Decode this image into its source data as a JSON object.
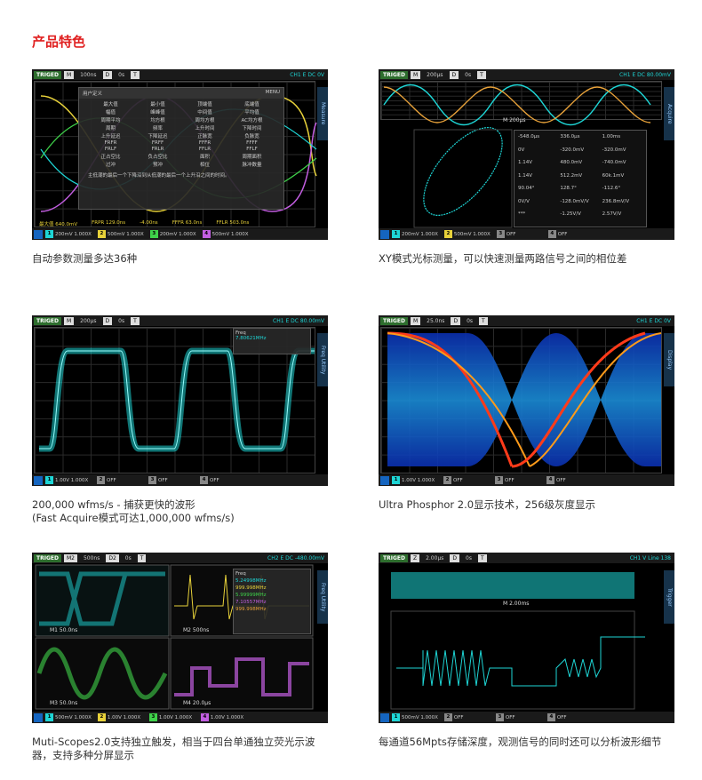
{
  "page_title": "产品特色",
  "cards": [
    {
      "caption": "自动参数测量多达36种",
      "top": {
        "trig": "TRIGED",
        "mode": "M",
        "timebase": "100ns",
        "delay_label": "D",
        "delay": "0s",
        "trig_label": "T",
        "trig_info": "CH1 E DC 0V"
      },
      "side_tab": "Measure",
      "menu_title": "用户定义",
      "menu_right": "MENU",
      "menu_items": [
        "最大值",
        "最小值",
        "顶端值",
        "底端值",
        "幅值",
        "峰峰值",
        "中间值",
        "平均值",
        "周期平均",
        "均方根",
        "周均方根",
        "AC均方根",
        "周期",
        "频率",
        "上升时间",
        "下降时间",
        "上升延迟",
        "下降延迟",
        "正脉宽",
        "负脉宽",
        "FRFR",
        "FRFF",
        "FFFR",
        "FFFF",
        "FRLF",
        "FRLR",
        "FFLR",
        "FFLF",
        "正占空比",
        "负占空比",
        "面积",
        "周期面积",
        "过冲",
        "预冲",
        "相位",
        "脉冲数量"
      ],
      "menu_note": "主低潮的最后一个下降沿到从低潮的最后一个上升沿之间的时间。",
      "meas_row": [
        "最大值 640.0mV",
        "FRPR 129.0ns",
        "-4.00ns",
        "FFFR 63.0ns",
        "FFLR 503.0ns"
      ],
      "channels": [
        "200mV 1.000X",
        "500mV 1.000X",
        "200mV 1.000X",
        "500mV 1.000X"
      ]
    },
    {
      "caption": "XY模式光标测量，可以快速测量两路信号之间的相位差",
      "top": {
        "trig": "TRIGED",
        "mode": "M",
        "timebase": "200μs",
        "delay_label": "D",
        "delay": "0s",
        "trig_label": "T",
        "trig_info": "CH1 E DC 80.00mV"
      },
      "side_tab": "Acquire",
      "sub_label": "M 200μs",
      "cursor_table": [
        "-548.0μs",
        "336.0μs",
        "1.00ms",
        "0V",
        "-320.0mV",
        "-320.0mV",
        "1.14V",
        "480.0mV",
        "-740.0mV",
        "1.14V",
        "512.2mV",
        "60k.1mV",
        "90.04°",
        "128.7°",
        "-112.6°",
        "0V/V",
        "-128.0mV/V",
        "236.8mV/V",
        "***",
        "-1.25V/V",
        "2.57V/V"
      ],
      "channels": [
        "200mV 1.000X",
        "500mV 1.000X",
        "OFF",
        "OFF"
      ]
    },
    {
      "caption": "200,000 wfms/s - 捕获更快的波形",
      "caption2": "(Fast Acquire模式可达1,000,000 wfms/s)",
      "top": {
        "trig": "TRIGED",
        "mode": "M",
        "timebase": "200μs",
        "delay_label": "D",
        "delay": "0s",
        "trig_label": "T",
        "trig_info": "CH1 E DC 80.00mV"
      },
      "side_tab": "Freq Utility",
      "freq_title": "Freq",
      "freq_value": "7.80621MHz",
      "channels": [
        "1.00V 1.000X",
        "OFF",
        "OFF",
        "OFF"
      ]
    },
    {
      "caption": "Ultra Phosphor 2.0显示技术，256级灰度显示",
      "top": {
        "trig": "TRIGED",
        "mode": "M",
        "timebase": "25.0ns",
        "delay_label": "D",
        "delay": "0s",
        "trig_label": "T",
        "trig_info": "CH1 E DC 0V"
      },
      "side_tab": "Display",
      "channels": [
        "1.00V 1.000X",
        "OFF",
        "OFF",
        "OFF"
      ]
    },
    {
      "caption": "Muti-Scopes2.0支持独立触发，相当于四台单通独立荧光示波器，支持多种分屏显示",
      "top": {
        "trig": "TRIGED",
        "mode": "M2",
        "timebase": "500ns",
        "delay_label": "D2",
        "delay": "0s",
        "trig_label": "T",
        "trig_info": "CH2 E DC -480.00mV"
      },
      "side_tab": "Freq Utility",
      "freq_title": "Freq",
      "freq_values": [
        "5.24998MHz",
        "999.998MHz",
        "5.99999MHz",
        "7.10557MHz",
        "999.998MHz"
      ],
      "pane_labels": [
        "M1 50.0ns",
        "M2 500ns",
        "M3 50.0ns",
        "M4 20.0μs"
      ],
      "channels": [
        "500mV 1.000X",
        "1.00V 1.000X",
        "1.00V 1.000X",
        "1.00V 1.000X"
      ]
    },
    {
      "caption": "每通道56Mpts存储深度，观测信号的同时还可以分析波形细节",
      "top": {
        "trig": "TRIGED",
        "mode": "Z",
        "timebase": "2.00μs",
        "delay_label": "D",
        "delay": "0s",
        "trig_label": "T",
        "trig_info": "CH1 V Line 138"
      },
      "side_tab": "Trigger",
      "sub_label": "M 2.00ms",
      "channels": [
        "500mV 1.000X",
        "OFF",
        "OFF",
        "OFF"
      ]
    }
  ],
  "colors": {
    "title": "#e02020",
    "ch1": "#1ed6d6",
    "ch2": "#e8d23a",
    "ch3": "#3fd24a",
    "ch4": "#c25ee0"
  }
}
